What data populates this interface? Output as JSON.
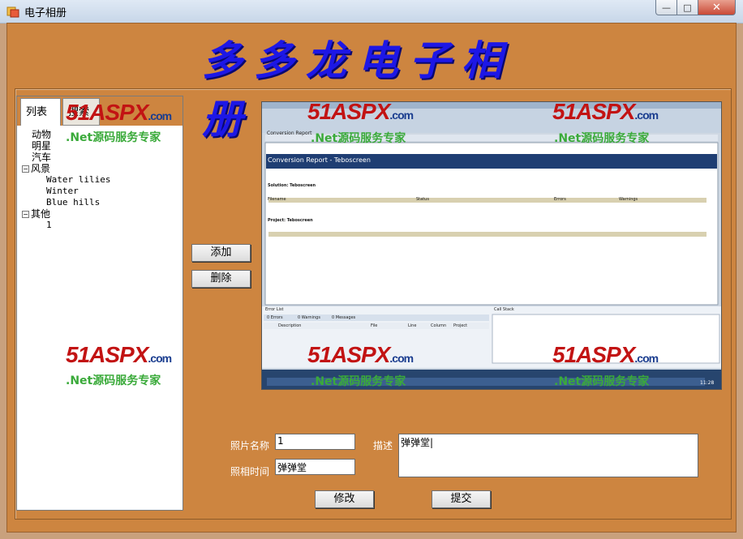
{
  "window": {
    "title": "电子相册",
    "controls": {
      "minimize": "—",
      "maximize": "□",
      "close": "✕"
    }
  },
  "header": {
    "title": "多多龙电子相册"
  },
  "tabs": [
    {
      "label": "列表"
    },
    {
      "label": "搜索"
    }
  ],
  "tree": {
    "nodes": [
      {
        "label": "动物"
      },
      {
        "label": "明星"
      },
      {
        "label": "汽车"
      },
      {
        "label": "风景",
        "expander": "−",
        "children": [
          {
            "label": "Water lilies"
          },
          {
            "label": "Winter"
          },
          {
            "label": "Blue hills"
          }
        ]
      },
      {
        "label": "其他",
        "expander": "−",
        "children": [
          {
            "label": "1"
          }
        ]
      }
    ]
  },
  "buttons": {
    "add": "添加",
    "delete": "删除",
    "modify": "修改",
    "submit": "提交"
  },
  "form": {
    "name_label": "照片名称",
    "name_value": "1",
    "time_label": "照相时间",
    "time_value": "弹弹堂",
    "desc_label": "描述",
    "desc_value": "弹弹堂|"
  },
  "watermark": {
    "logo": "51ASPX",
    "logo_suffix": ".com",
    "slogan": ".Net源码服务专家"
  },
  "photo": {
    "report_title": "Conversion Report - Teboscreen",
    "tab": "Conversion Report",
    "solution_label": "Solution: Teboscreen",
    "project_label": "Project: Teboscreen",
    "columns": [
      "Filename",
      "Status",
      "Errors",
      "Warnings"
    ],
    "panels": [
      "Error List",
      "Call Stack"
    ],
    "error_tabs": [
      "0 Errors",
      "0 Warnings",
      "0 Messages"
    ],
    "error_cols": [
      "Description",
      "File",
      "Line",
      "Column",
      "Project"
    ],
    "time": "11:28"
  },
  "colors": {
    "client": "#cd8540",
    "heading": "#1d17e6",
    "outer": "#c9a17d"
  }
}
